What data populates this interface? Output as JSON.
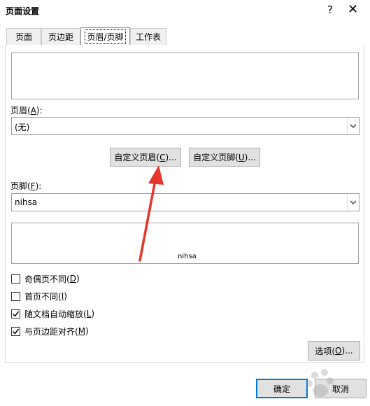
{
  "dialog": {
    "title": "页面设置",
    "help": "?",
    "close": "✕"
  },
  "tabs": [
    "页面",
    "页边距",
    "页眉/页脚",
    "工作表"
  ],
  "header": {
    "label": "页眉(",
    "key": "A",
    "label_end": "):",
    "value": "(无)"
  },
  "buttons": {
    "custom_header_pre": "自定义页眉(",
    "custom_header_key": "C",
    "custom_header_post": ")...",
    "custom_footer_pre": "自定义页脚(",
    "custom_footer_key": "U",
    "custom_footer_post": ")...",
    "options_pre": "选项(",
    "options_key": "O",
    "options_post": ")...",
    "ok": "确定",
    "cancel": "取消"
  },
  "footer": {
    "label": "页脚(",
    "key": "F",
    "label_end": "):",
    "value": "nihsa",
    "preview_text": "nihsa"
  },
  "checkboxes": [
    {
      "pre": "奇偶页不同(",
      "key": "D",
      "post": ")",
      "checked": false
    },
    {
      "pre": "首页不同(",
      "key": "I",
      "post": ")",
      "checked": false
    },
    {
      "pre": "随文档自动缩放(",
      "key": "L",
      "post": ")",
      "checked": true
    },
    {
      "pre": "与页边距对齐(",
      "key": "M",
      "post": ")",
      "checked": true
    }
  ],
  "icons": {
    "dropdown": "chevron-down-icon",
    "check": "checkmark-icon"
  },
  "colors": {
    "accent": "#0078d7",
    "arrow": "#e8352b",
    "button_bg": "#e1e1e1"
  }
}
